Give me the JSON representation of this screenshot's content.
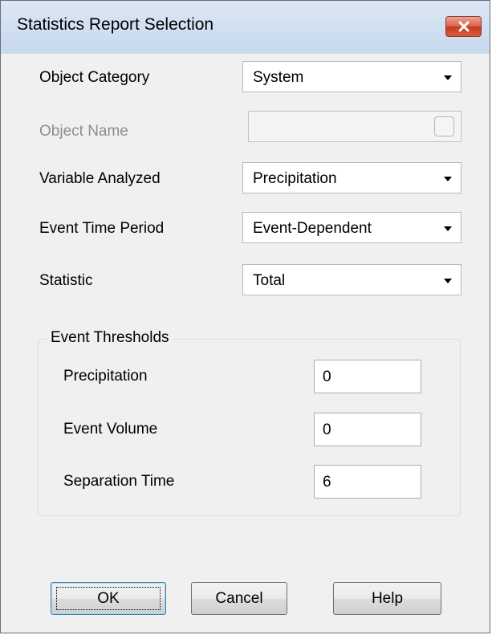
{
  "window": {
    "title": "Statistics Report Selection",
    "close_icon": "close-icon"
  },
  "form": {
    "object_category": {
      "label": "Object Category",
      "value": "System"
    },
    "object_name": {
      "label": "Object Name",
      "value": ""
    },
    "variable_analyzed": {
      "label": "Variable Analyzed",
      "value": "Precipitation"
    },
    "event_time_period": {
      "label": "Event Time Period",
      "value": "Event-Dependent"
    },
    "statistic": {
      "label": "Statistic",
      "value": "Total"
    }
  },
  "thresholds": {
    "title": "Event Thresholds",
    "precipitation": {
      "label": "Precipitation",
      "value": "0"
    },
    "event_volume": {
      "label": "Event Volume",
      "value": "0"
    },
    "separation_time": {
      "label": "Separation Time",
      "value": "6"
    }
  },
  "buttons": {
    "ok": "OK",
    "cancel": "Cancel",
    "help": "Help"
  },
  "colors": {
    "title_bar": "#c7d9ee",
    "close_button": "#c73a21",
    "dialog_background": "#f0f0f0",
    "disabled_text": "#8e8e8e"
  }
}
